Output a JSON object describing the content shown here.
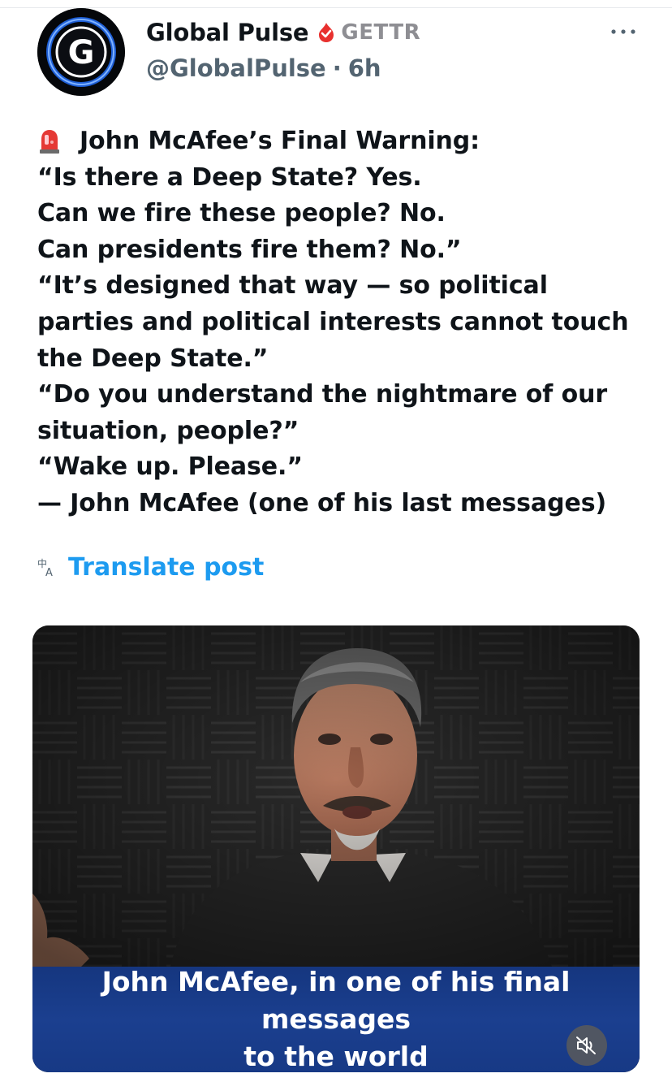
{
  "author": {
    "display_name": "Global Pulse",
    "badge_label": "GETTR",
    "handle": "@GlobalPulse",
    "separator": "·",
    "time_ago": "6h",
    "avatar_letter": "G"
  },
  "post": {
    "lines": [
      "John McAfee’s Final Warning:",
      "“Is there a Deep State? Yes.",
      "Can we fire these people? No.",
      "Can presidents fire them? No.”",
      "“It’s designed that way — so political",
      "parties and political interests cannot touch",
      "the Deep State.”",
      "“Do you understand the nightmare of our",
      "situation, people?”",
      "“Wake up. Please.”",
      "— John McAfee (one of his last messages)"
    ],
    "translate_label": "Translate post"
  },
  "media": {
    "caption_line1": "John McAfee, in one of his final messages",
    "caption_line2": "to the world"
  },
  "icons": {
    "more": "more-options-icon",
    "siren": "siren-emoji-icon",
    "translate": "translate-icon",
    "mute": "muted-speaker-icon",
    "badge": "gettr-flame-icon"
  },
  "colors": {
    "accent": "#1d9bf0",
    "badge_red": "#e8302e",
    "caption_bg": "#1b3f8f",
    "muted_text": "#536471"
  }
}
